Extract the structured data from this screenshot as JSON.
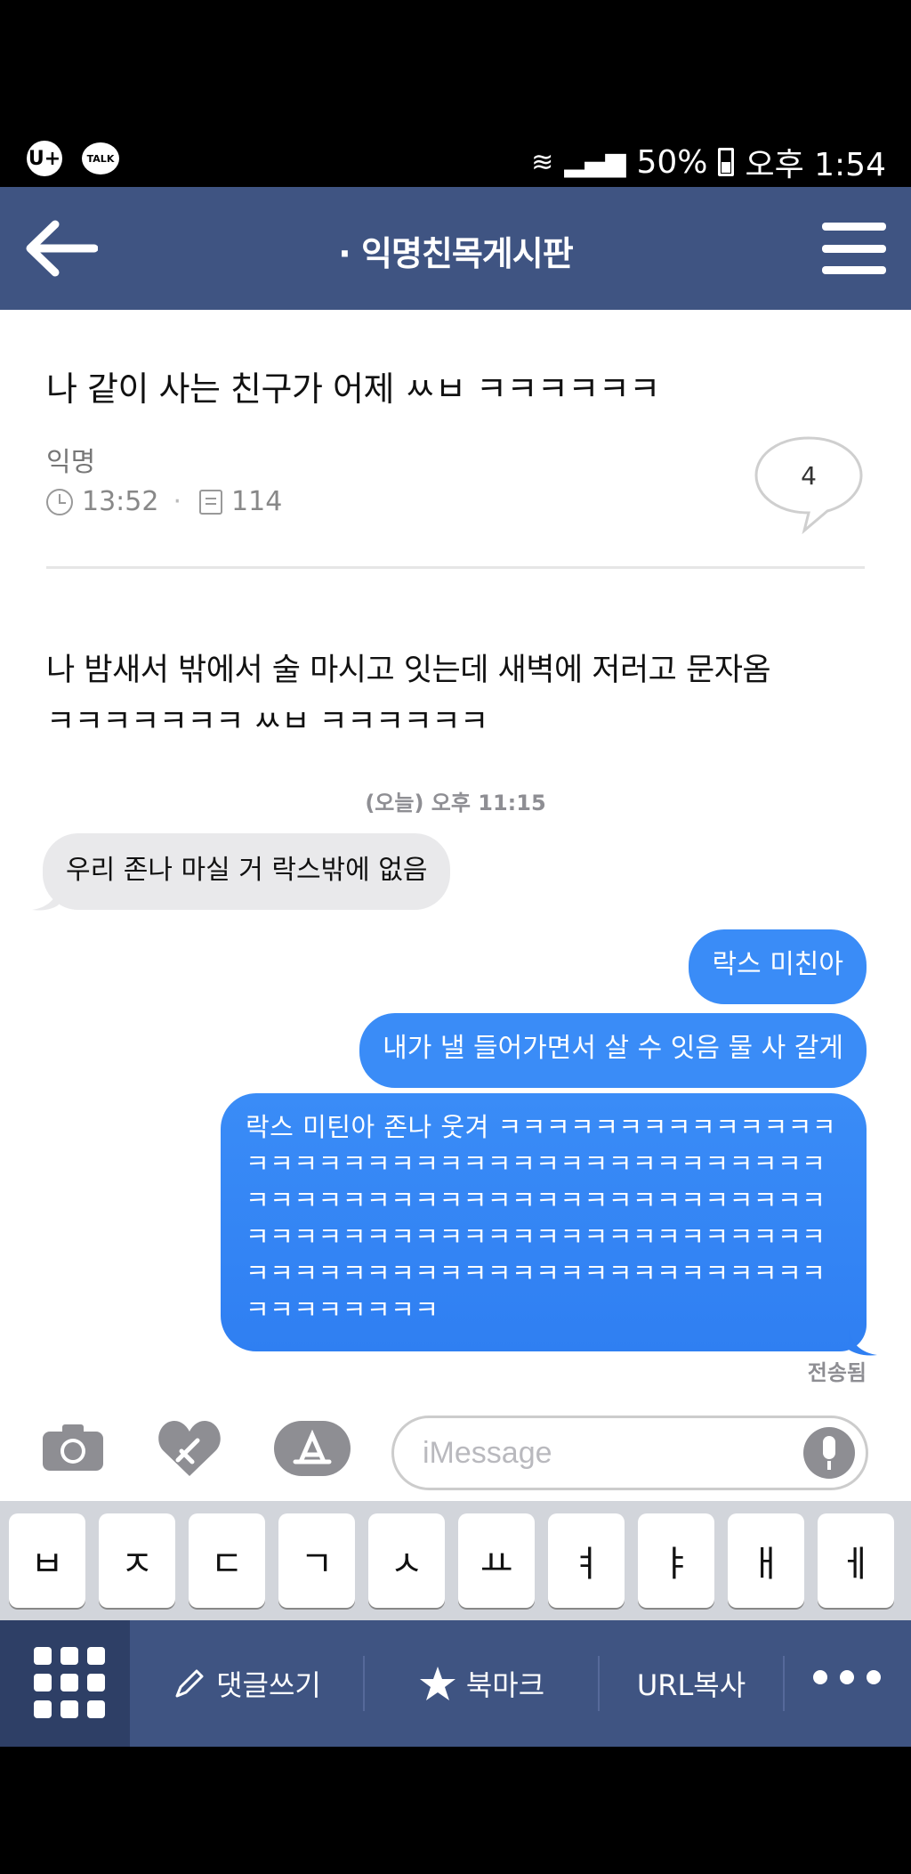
{
  "status_bar": {
    "left_icons": [
      "U+",
      "TALK"
    ],
    "battery": "50%",
    "time": "오후 1:54"
  },
  "header": {
    "title": "· 익명친목게시판"
  },
  "post": {
    "title": "나 같이 사는 친구가 어제 ㅆㅂ ㅋㅋㅋㅋㅋㅋ",
    "author": "익명",
    "time": "13:52",
    "views": "114",
    "comment_count": "4",
    "body_line1": "나 밤새서 밖에서 술 마시고 잇는데 새벽에 저러고 문자옴",
    "body_line2": "ㅋㅋㅋㅋㅋㅋㅋ ㅆㅂ ㅋㅋㅋㅋㅋㅋ"
  },
  "chat": {
    "timestamp": "(오늘) 오후 11:15",
    "incoming": "우리 존나 마실 거 락스밖에 없음",
    "outgoing1": "락스 미친아",
    "outgoing2": "내가 낼 들어가면서 살 수 잇음 물 사 갈게",
    "outgoing3": "락스 미틴아 존나 웃겨 ㅋㅋㅋㅋㅋㅋㅋㅋㅋㅋㅋㅋㅋㅋㅋㅋㅋㅋㅋㅋㅋㅋㅋㅋㅋㅋㅋㅋㅋㅋㅋㅋㅋㅋㅋㅋㅋㅋㅋㅋㅋㅋㅋㅋㅋㅋㅋㅋㅋㅋㅋㅋㅋㅋㅋㅋㅋㅋㅋㅋㅋㅋㅋㅋㅋㅋㅋㅋㅋㅋㅋㅋㅋㅋㅋㅋㅋㅋㅋㅋㅋㅋㅋㅋㅋㅋㅋㅋㅋㅋㅋㅋㅋㅋㅋㅋㅋㅋㅋㅋㅋㅋㅋㅋㅋㅋㅋㅋㅋㅋㅋㅋㅋㅋㅋㅋㅋㅋ",
    "delivered": "전송됨",
    "input_placeholder": "iMessage",
    "keyboard_keys": [
      "ㅂ",
      "ㅈ",
      "ㄷ",
      "ㄱ",
      "ㅅ",
      "ㅛ",
      "ㅕ",
      "ㅑ",
      "ㅐ",
      "ㅔ"
    ]
  },
  "toolbar": {
    "comment_label": "댓글쓰기",
    "bookmark_label": "북마크",
    "url_copy_label": "URL복사"
  },
  "colors": {
    "header_bg": "#3f5482",
    "bubble_blue": "#3a8cf7",
    "bubble_gray": "#e9e9eb"
  },
  "icons": [
    "back-arrow-icon",
    "menu-icon",
    "clock-icon",
    "view-count-icon",
    "comment-bubble-icon",
    "camera-icon",
    "digital-touch-heart-icon",
    "app-store-icon",
    "microphone-icon",
    "grid-menu-icon",
    "pencil-icon",
    "star-icon",
    "more-icon"
  ]
}
